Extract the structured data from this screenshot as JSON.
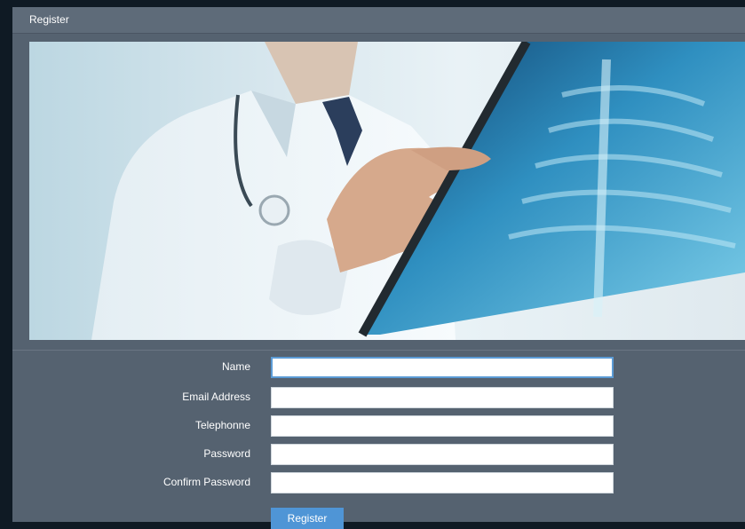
{
  "panel": {
    "title": "Register"
  },
  "form": {
    "fields": [
      {
        "label": "Name",
        "value": "",
        "placeholder": ""
      },
      {
        "label": "Email Address",
        "value": "",
        "placeholder": ""
      },
      {
        "label": "Telephonne",
        "value": "",
        "placeholder": ""
      },
      {
        "label": "Password",
        "value": "",
        "placeholder": ""
      },
      {
        "label": "Confirm Password",
        "value": "",
        "placeholder": ""
      }
    ],
    "submit_label": "Register"
  },
  "hero": {
    "image_subject": "doctor-holding-chest-xray"
  },
  "colors": {
    "panel": "#556270",
    "header": "#5e6b79",
    "button": "#4f95d6",
    "background": "#0f1a24"
  }
}
